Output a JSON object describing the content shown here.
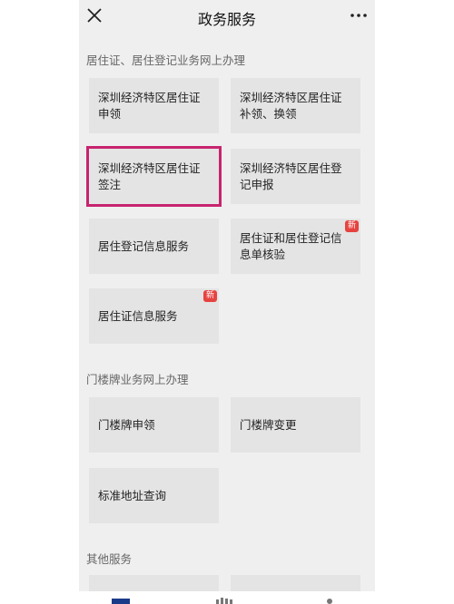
{
  "header": {
    "title": "政务服务",
    "close_icon": "close-icon",
    "more_icon": "more-icon"
  },
  "sections": [
    {
      "title": "居住证、居住登记业务网上办理",
      "tiles": [
        {
          "label": "深圳经济特区居住证申领"
        },
        {
          "label": "深圳经济特区居住证补领、换领"
        },
        {
          "label": "深圳经济特区居住证签注",
          "highlighted": true
        },
        {
          "label": "深圳经济特区居住登记申报"
        },
        {
          "label": "居住登记信息服务"
        },
        {
          "label": "居住证和居住登记信息单核验",
          "badge": "新"
        },
        {
          "label": "居住证信息服务",
          "badge": "新"
        }
      ]
    },
    {
      "title": "门楼牌业务网上办理",
      "tiles": [
        {
          "label": "门楼牌申领"
        },
        {
          "label": "门楼牌变更"
        },
        {
          "label": "标准地址查询"
        }
      ]
    },
    {
      "title": "其他服务",
      "tiles": []
    }
  ],
  "tabbar": {
    "icons": [
      "home-icon",
      "grid-icon",
      "user-icon"
    ]
  },
  "colors": {
    "background": "#efefef",
    "tile": "#e4e4e4",
    "highlight": "#c8246f",
    "badge": "#e64340",
    "tab_active": "#1a3a8a"
  }
}
